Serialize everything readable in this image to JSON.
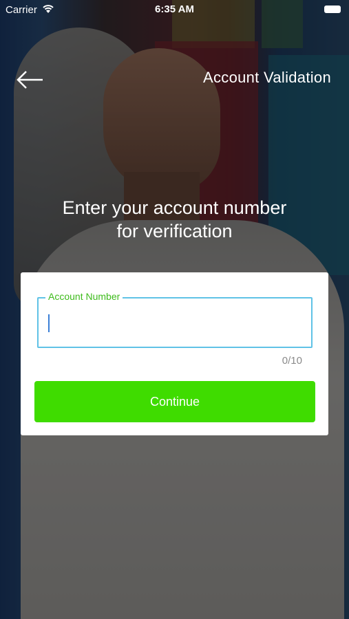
{
  "status_bar": {
    "carrier": "Carrier",
    "time": "6:35 AM"
  },
  "header": {
    "title": "Account Validation",
    "back_icon": "back-arrow-icon"
  },
  "main": {
    "heading": "Enter your account number\nfor verification"
  },
  "form": {
    "account_label": "Account Number",
    "account_value": "",
    "counter": "0/10",
    "continue_label": "Continue"
  },
  "colors": {
    "accent": "#3fdc00",
    "field_border": "#5fc2e6",
    "label": "#3dbb1b"
  }
}
